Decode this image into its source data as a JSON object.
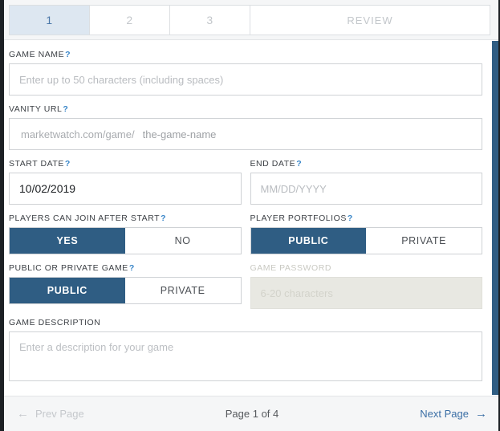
{
  "wizard": {
    "tabs": [
      {
        "label": "1",
        "active": true
      },
      {
        "label": "2",
        "active": false
      },
      {
        "label": "3",
        "active": false
      },
      {
        "label": "REVIEW",
        "active": false
      }
    ]
  },
  "help_icon": "?",
  "form": {
    "game_name": {
      "label": "GAME NAME",
      "value": "",
      "placeholder": "Enter up to 50 characters (including spaces)"
    },
    "vanity_url": {
      "label": "VANITY URL",
      "prefix": "marketwatch.com/game/",
      "value": "",
      "placeholder": "the-game-name"
    },
    "start_date": {
      "label": "START DATE",
      "value": "10/02/2019",
      "placeholder": "MM/DD/YYYY"
    },
    "end_date": {
      "label": "END DATE",
      "value": "",
      "placeholder": "MM/DD/YYYY"
    },
    "join_after_start": {
      "label": "PLAYERS CAN JOIN AFTER START",
      "options": [
        "YES",
        "NO"
      ],
      "selected": "YES"
    },
    "player_portfolios": {
      "label": "PLAYER PORTFOLIOS",
      "options": [
        "PUBLIC",
        "PRIVATE"
      ],
      "selected": "PUBLIC"
    },
    "public_or_private_game": {
      "label": "PUBLIC OR PRIVATE GAME",
      "options": [
        "PUBLIC",
        "PRIVATE"
      ],
      "selected": "PUBLIC"
    },
    "game_password": {
      "label": "GAME PASSWORD",
      "value": "",
      "placeholder": "6-20 characters",
      "disabled": true
    },
    "game_description": {
      "label": "GAME DESCRIPTION",
      "value": "",
      "placeholder": "Enter a description for your game"
    }
  },
  "footer": {
    "prev_label": "Prev Page",
    "prev_arrow": "←",
    "page_indicator": "Page 1 of 4",
    "next_label": "Next Page",
    "next_arrow": "→"
  },
  "colors": {
    "accent_navy": "#2f5d83",
    "active_tab_bg": "#dde7f1",
    "active_tab_text": "#4a77a8",
    "help_blue": "#3a86c8",
    "link_blue": "#3a6ea5",
    "disabled_bg": "#e8e8e2"
  }
}
